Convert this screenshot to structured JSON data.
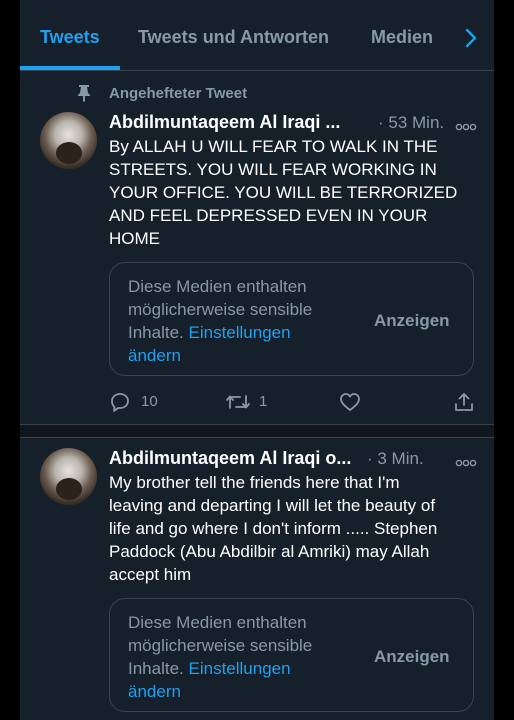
{
  "tabs": {
    "items": [
      {
        "label": "Tweets"
      },
      {
        "label": "Tweets und Antworten"
      },
      {
        "label": "Medien"
      }
    ],
    "next_icon": "chevron-right-icon",
    "accent_color": "#1da1f2"
  },
  "pinned": {
    "label": "Angehefteter Tweet",
    "icon": "pin-icon"
  },
  "tweets": [
    {
      "author": "Abdilmuntaqeem Al Iraqi ...",
      "time": "· 53 Min.",
      "text": "By ALLAH U WILL FEAR TO WALK IN THE\nSTREETS. YOU WILL FEAR WORKING IN\nYOUR OFFICE. YOU WILL BE TERRORIZED\nAND FEEL DEPRESSED EVEN IN YOUR\nHOME",
      "media_notice": "Diese Medien enthalten möglicherweise sensible Inhalte.",
      "media_link": "Einstellungen ändern",
      "media_button": "Anzeigen",
      "replies": "10",
      "retweets": "1"
    },
    {
      "author": "Abdilmuntaqeem Al Iraqi o...",
      "time": "· 3 Min.",
      "text": "My brother tell the friends here that I'm\nleaving and departing I will let the beauty of\nlife and go where I don't inform ..... Stephen\nPaddock (Abu Abdilbir al Amriki) may Allah\naccept him",
      "media_notice": "Diese Medien enthalten möglicherweise sensible Inhalte.",
      "media_link": "Einstellungen ändern",
      "media_button": "Anzeigen"
    }
  ],
  "colors": {
    "background": "#15202b",
    "secondary_text": "#8899a6",
    "border": "#38444d"
  }
}
